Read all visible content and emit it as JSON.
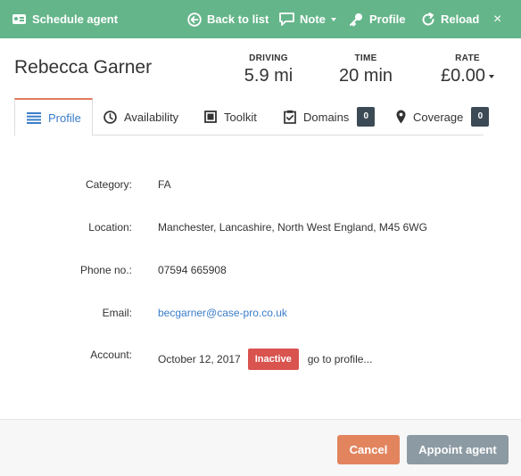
{
  "header": {
    "title": "Schedule agent",
    "back_label": "Back to list",
    "note_label": "Note",
    "profile_label": "Profile",
    "reload_label": "Reload",
    "close_label": "×"
  },
  "agent": {
    "name": "Rebecca Garner"
  },
  "stats": {
    "driving": {
      "label": "DRIVING",
      "value": "5.9 mi"
    },
    "time": {
      "label": "TIME",
      "value": "20 min"
    },
    "rate": {
      "label": "RATE",
      "value": "£0.00"
    }
  },
  "tabs": [
    {
      "label": "Profile",
      "active": true
    },
    {
      "label": "Availability"
    },
    {
      "label": "Toolkit"
    },
    {
      "label": "Domains",
      "badge": "0"
    },
    {
      "label": "Coverage",
      "badge": "0"
    }
  ],
  "details": {
    "category": {
      "label": "Category:",
      "value": "FA"
    },
    "location": {
      "label": "Location:",
      "value": "Manchester, Lancashire, North West England, M45 6WG"
    },
    "phone": {
      "label": "Phone no.:",
      "value": "07594 665908"
    },
    "email": {
      "label": "Email:",
      "value": "becgarner@case-pro.co.uk"
    },
    "account": {
      "label": "Account:",
      "date": "October 12, 2017",
      "status": "Inactive",
      "link": "go to profile..."
    }
  },
  "footer": {
    "cancel_label": "Cancel",
    "appoint_label": "Appoint agent"
  },
  "colors": {
    "header": "#65b58a",
    "link": "#3a7dc9",
    "inactive": "#d9534f",
    "cancel": "#e2855f",
    "appoint": "#8c9aa3",
    "badge": "#3c4a55"
  }
}
